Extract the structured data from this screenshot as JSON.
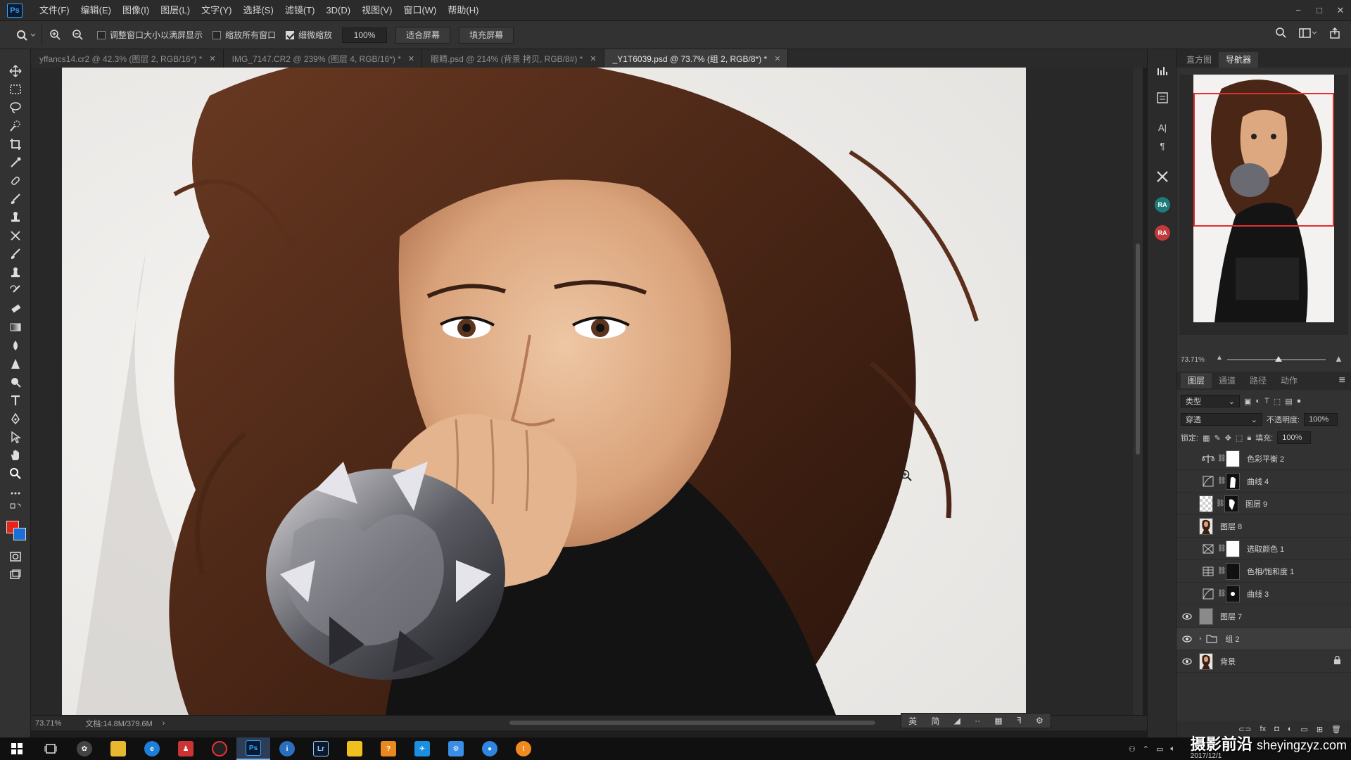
{
  "menubar": {
    "logo": "Ps",
    "items": [
      "文件(F)",
      "编辑(E)",
      "图像(I)",
      "图层(L)",
      "文字(Y)",
      "选择(S)",
      "滤镜(T)",
      "3D(D)",
      "视图(V)",
      "窗口(W)",
      "帮助(H)"
    ],
    "window_controls": [
      "−",
      "□",
      "✕"
    ]
  },
  "options": {
    "resize_window_label": "调整窗口大小以满屏显示",
    "resize_window_checked": false,
    "zoom_all_label": "缩放所有窗口",
    "zoom_all_checked": false,
    "scrubby_label": "细微缩放",
    "scrubby_checked": true,
    "zoom_value": "100%",
    "fit_screen": "适合屏幕",
    "fill_screen": "填充屏幕"
  },
  "tabs": [
    {
      "label": "yffancs14.cr2 @ 42.3% (图层 2, RGB/16*) *",
      "active": false
    },
    {
      "label": "IMG_7147.CR2 @ 239% (图层 4, RGB/16*) *",
      "active": false
    },
    {
      "label": "眼睛.psd @ 214% (背景 拷贝, RGB/8#) *",
      "active": false
    },
    {
      "label": "_Y1T6039.psd @ 73.7% (组 2, RGB/8*) *",
      "active": true
    }
  ],
  "status": {
    "zoom": "73.71%",
    "doc_size": "文档:14.8M/379.6M"
  },
  "ime": [
    "英",
    "简",
    "◢",
    "··",
    "▦",
    "ꟻ",
    "⚙"
  ],
  "navigator": {
    "tabs": [
      "直方图",
      "导航器"
    ],
    "active_tab": "导航器",
    "zoom": "73.71%"
  },
  "layers_panel": {
    "tabs": [
      "图层",
      "通道",
      "路径",
      "动作"
    ],
    "active_tab": "图层",
    "filter_kind": "类型",
    "blend_mode": "穿透",
    "opacity_label": "不透明度:",
    "opacity": "100%",
    "lock_label": "锁定:",
    "fill_label": "填充:",
    "fill": "100%",
    "layers": [
      {
        "name": "色彩平衡 2",
        "visible": false,
        "type": "adjustment",
        "icon": "balance-icon"
      },
      {
        "name": "曲线 4",
        "visible": false,
        "type": "adjustment",
        "icon": "curves-icon"
      },
      {
        "name": "图层 9",
        "visible": false,
        "type": "pixel-mask"
      },
      {
        "name": "图层 8",
        "visible": false,
        "type": "pixel"
      },
      {
        "name": "选取颜色 1",
        "visible": false,
        "type": "adjustment",
        "icon": "selective-color-icon"
      },
      {
        "name": "色相/饱和度 1",
        "visible": false,
        "type": "adjustment",
        "icon": "hue-saturation-icon"
      },
      {
        "name": "曲线 3",
        "visible": false,
        "type": "adjustment",
        "icon": "curves-icon"
      },
      {
        "name": "图层 7",
        "visible": true,
        "type": "pixel-gray"
      },
      {
        "name": "组 2",
        "visible": true,
        "type": "group",
        "selected": true
      },
      {
        "name": "背景",
        "visible": true,
        "type": "background",
        "locked": true
      }
    ],
    "footer_fx": "fx"
  },
  "side_strip": {
    "ra1": "RA",
    "ra2": "RA",
    "char_glyph": "A|",
    "para_glyph": "¶"
  },
  "taskbar": {
    "apps": [
      "Ps",
      "Lr"
    ],
    "watermark": "摄影前沿",
    "watermark_url": "sheyingzyz.com",
    "date_partial": "2017/12/1"
  },
  "colors": {
    "foreground": "#e8241a",
    "background": "#1d6fd8",
    "accent": "#31a8ff",
    "nav_frame": "#e03030"
  }
}
